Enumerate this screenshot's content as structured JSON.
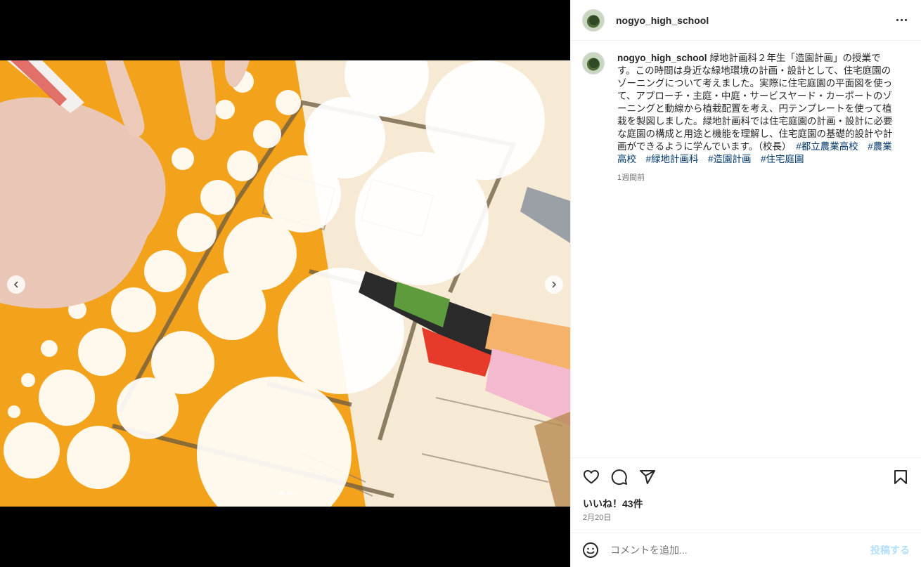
{
  "post": {
    "username": "nogyo_high_school",
    "caption": "緑地計画科２年生「造園計画」の授業です。この時間は身近な緑地環境の計画・設計として、住宅庭園のゾーニングについて考えました。実際に住宅庭園の平面図を使って、アプローチ・主庭・中庭・サービスヤード・カーポートのゾーニングと動線から植栽配置を考え、円テンプレートを使って植栽を製図しました。緑地計画科では住宅庭園の計画・設計に必要な庭園の構成と用途と機能を理解し、住宅庭園の基礎的設計や計画ができるように学んでいます。（校長）",
    "hashtags": [
      "#都立農業高校",
      "#農業高校",
      "#緑地計画科",
      "#造園計画",
      "#住宅庭園"
    ],
    "time_ago": "1週間前",
    "likes": "いいね！43件",
    "date": "2月20日"
  },
  "carousel": {
    "dot_count": 4,
    "active_index": 1
  },
  "comment": {
    "placeholder": "コメントを追加...",
    "post_label": "投稿する"
  },
  "icons": {
    "more": "more-icon",
    "prev": "chevron-left-icon",
    "next": "chevron-right-icon",
    "like": "heart-icon",
    "comment": "comment-icon",
    "share": "share-icon",
    "save": "bookmark-icon",
    "emoji": "emoji-icon"
  },
  "colors": {
    "hashtag": "#00376b",
    "template_orange": "#f2a11f",
    "post_button": "#b2dffc"
  }
}
